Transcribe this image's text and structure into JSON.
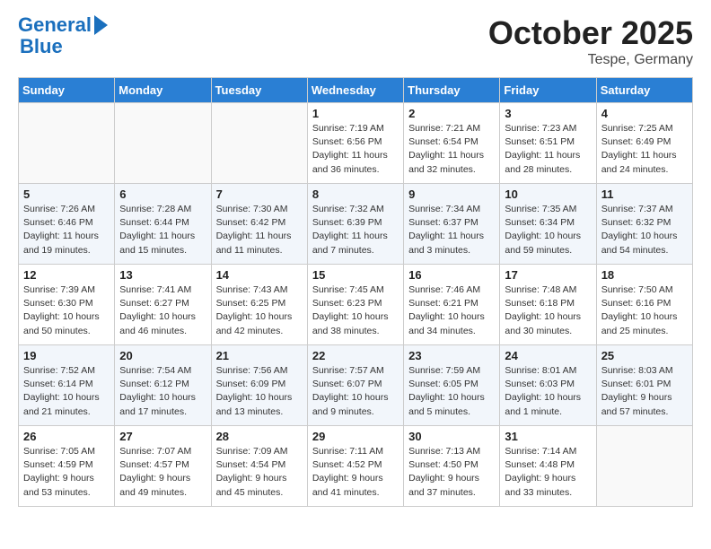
{
  "header": {
    "logo_line1": "General",
    "logo_line2": "Blue",
    "month": "October 2025",
    "location": "Tespe, Germany"
  },
  "weekdays": [
    "Sunday",
    "Monday",
    "Tuesday",
    "Wednesday",
    "Thursday",
    "Friday",
    "Saturday"
  ],
  "weeks": [
    [
      {
        "day": "",
        "info": ""
      },
      {
        "day": "",
        "info": ""
      },
      {
        "day": "",
        "info": ""
      },
      {
        "day": "1",
        "info": "Sunrise: 7:19 AM\nSunset: 6:56 PM\nDaylight: 11 hours\nand 36 minutes."
      },
      {
        "day": "2",
        "info": "Sunrise: 7:21 AM\nSunset: 6:54 PM\nDaylight: 11 hours\nand 32 minutes."
      },
      {
        "day": "3",
        "info": "Sunrise: 7:23 AM\nSunset: 6:51 PM\nDaylight: 11 hours\nand 28 minutes."
      },
      {
        "day": "4",
        "info": "Sunrise: 7:25 AM\nSunset: 6:49 PM\nDaylight: 11 hours\nand 24 minutes."
      }
    ],
    [
      {
        "day": "5",
        "info": "Sunrise: 7:26 AM\nSunset: 6:46 PM\nDaylight: 11 hours\nand 19 minutes."
      },
      {
        "day": "6",
        "info": "Sunrise: 7:28 AM\nSunset: 6:44 PM\nDaylight: 11 hours\nand 15 minutes."
      },
      {
        "day": "7",
        "info": "Sunrise: 7:30 AM\nSunset: 6:42 PM\nDaylight: 11 hours\nand 11 minutes."
      },
      {
        "day": "8",
        "info": "Sunrise: 7:32 AM\nSunset: 6:39 PM\nDaylight: 11 hours\nand 7 minutes."
      },
      {
        "day": "9",
        "info": "Sunrise: 7:34 AM\nSunset: 6:37 PM\nDaylight: 11 hours\nand 3 minutes."
      },
      {
        "day": "10",
        "info": "Sunrise: 7:35 AM\nSunset: 6:34 PM\nDaylight: 10 hours\nand 59 minutes."
      },
      {
        "day": "11",
        "info": "Sunrise: 7:37 AM\nSunset: 6:32 PM\nDaylight: 10 hours\nand 54 minutes."
      }
    ],
    [
      {
        "day": "12",
        "info": "Sunrise: 7:39 AM\nSunset: 6:30 PM\nDaylight: 10 hours\nand 50 minutes."
      },
      {
        "day": "13",
        "info": "Sunrise: 7:41 AM\nSunset: 6:27 PM\nDaylight: 10 hours\nand 46 minutes."
      },
      {
        "day": "14",
        "info": "Sunrise: 7:43 AM\nSunset: 6:25 PM\nDaylight: 10 hours\nand 42 minutes."
      },
      {
        "day": "15",
        "info": "Sunrise: 7:45 AM\nSunset: 6:23 PM\nDaylight: 10 hours\nand 38 minutes."
      },
      {
        "day": "16",
        "info": "Sunrise: 7:46 AM\nSunset: 6:21 PM\nDaylight: 10 hours\nand 34 minutes."
      },
      {
        "day": "17",
        "info": "Sunrise: 7:48 AM\nSunset: 6:18 PM\nDaylight: 10 hours\nand 30 minutes."
      },
      {
        "day": "18",
        "info": "Sunrise: 7:50 AM\nSunset: 6:16 PM\nDaylight: 10 hours\nand 25 minutes."
      }
    ],
    [
      {
        "day": "19",
        "info": "Sunrise: 7:52 AM\nSunset: 6:14 PM\nDaylight: 10 hours\nand 21 minutes."
      },
      {
        "day": "20",
        "info": "Sunrise: 7:54 AM\nSunset: 6:12 PM\nDaylight: 10 hours\nand 17 minutes."
      },
      {
        "day": "21",
        "info": "Sunrise: 7:56 AM\nSunset: 6:09 PM\nDaylight: 10 hours\nand 13 minutes."
      },
      {
        "day": "22",
        "info": "Sunrise: 7:57 AM\nSunset: 6:07 PM\nDaylight: 10 hours\nand 9 minutes."
      },
      {
        "day": "23",
        "info": "Sunrise: 7:59 AM\nSunset: 6:05 PM\nDaylight: 10 hours\nand 5 minutes."
      },
      {
        "day": "24",
        "info": "Sunrise: 8:01 AM\nSunset: 6:03 PM\nDaylight: 10 hours\nand 1 minute."
      },
      {
        "day": "25",
        "info": "Sunrise: 8:03 AM\nSunset: 6:01 PM\nDaylight: 9 hours\nand 57 minutes."
      }
    ],
    [
      {
        "day": "26",
        "info": "Sunrise: 7:05 AM\nSunset: 4:59 PM\nDaylight: 9 hours\nand 53 minutes."
      },
      {
        "day": "27",
        "info": "Sunrise: 7:07 AM\nSunset: 4:57 PM\nDaylight: 9 hours\nand 49 minutes."
      },
      {
        "day": "28",
        "info": "Sunrise: 7:09 AM\nSunset: 4:54 PM\nDaylight: 9 hours\nand 45 minutes."
      },
      {
        "day": "29",
        "info": "Sunrise: 7:11 AM\nSunset: 4:52 PM\nDaylight: 9 hours\nand 41 minutes."
      },
      {
        "day": "30",
        "info": "Sunrise: 7:13 AM\nSunset: 4:50 PM\nDaylight: 9 hours\nand 37 minutes."
      },
      {
        "day": "31",
        "info": "Sunrise: 7:14 AM\nSunset: 4:48 PM\nDaylight: 9 hours\nand 33 minutes."
      },
      {
        "day": "",
        "info": ""
      }
    ]
  ]
}
